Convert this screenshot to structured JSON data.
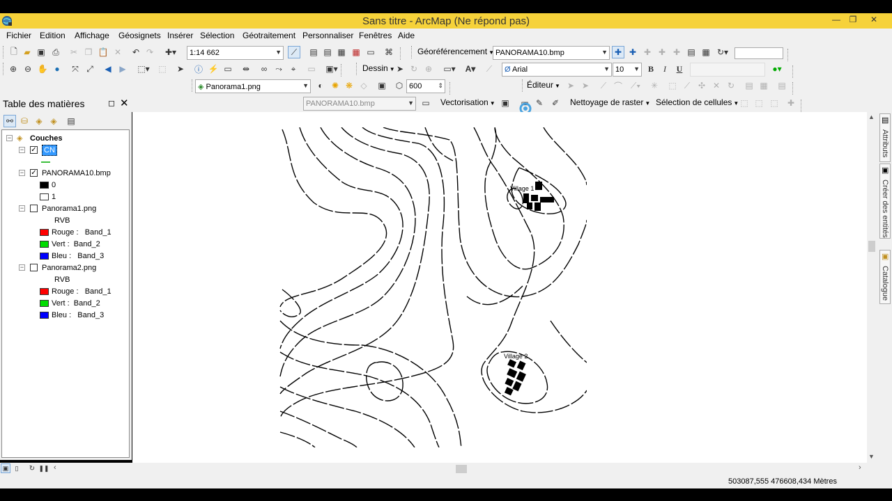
{
  "window": {
    "title": "Sans titre - ArcMap (Ne répond pas)",
    "minimize_icon": "minimize-icon",
    "maximize_icon": "restore-icon",
    "close_icon": "close-icon"
  },
  "menu": {
    "items": [
      "Fichier",
      "Edition",
      "Affichage",
      "Géosignets",
      "Insérer",
      "Sélection",
      "Géotraitement",
      "Personnaliser",
      "Fenêtres",
      "Aide"
    ]
  },
  "toolbar": {
    "scale_value": "1:14 662",
    "georef_label": "Géoréférencement",
    "georef_layer": "PANORAMA10.bmp",
    "dessin_label": "Dessin",
    "font_name": "Arial",
    "font_size": "10",
    "bold_label": "B",
    "italic_label": "I",
    "underline_label": "U",
    "layer_combo": "Panorama1.png",
    "transparency_value": "600",
    "editor_label": "Éditeur",
    "vector_layer": "PANORAMA10.bmp",
    "vectorisation_label": "Vectorisation",
    "cleanup_label": "Nettoyage de raster",
    "cell_selection_label": "Sélection de cellules"
  },
  "toc": {
    "title": "Table des matières",
    "group_label": "Couches",
    "layers": [
      {
        "name": "CN",
        "checked": true,
        "selected": true
      },
      {
        "name": "PANORAMA10.bmp",
        "checked": true,
        "classes": [
          {
            "label": "0",
            "color": "#000000"
          },
          {
            "label": "1",
            "color": "#ffffff"
          }
        ]
      },
      {
        "name": "Panorama1.png",
        "checked": false,
        "rgb_label": "RVB",
        "bands": [
          {
            "label": "Rouge :   Band_1",
            "color": "#ff0000"
          },
          {
            "label": "Vert :  Band_2",
            "color": "#00dd00"
          },
          {
            "label": "Bleu :   Band_3",
            "color": "#0000ff"
          }
        ]
      },
      {
        "name": "Panorama2.png",
        "checked": false,
        "rgb_label": "RVB",
        "bands": [
          {
            "label": "Rouge :   Band_1",
            "color": "#ff0000"
          },
          {
            "label": "Vert :  Band_2",
            "color": "#00dd00"
          },
          {
            "label": "Bleu :   Band_3",
            "color": "#0000ff"
          }
        ]
      }
    ]
  },
  "map": {
    "village1_label": "Village 1",
    "village2_label": "Village 2"
  },
  "side_tabs": [
    "Attributs",
    "Créer des entités",
    "Catalogue"
  ],
  "status": {
    "coords": "503087,555  476608,434 Mètres"
  }
}
